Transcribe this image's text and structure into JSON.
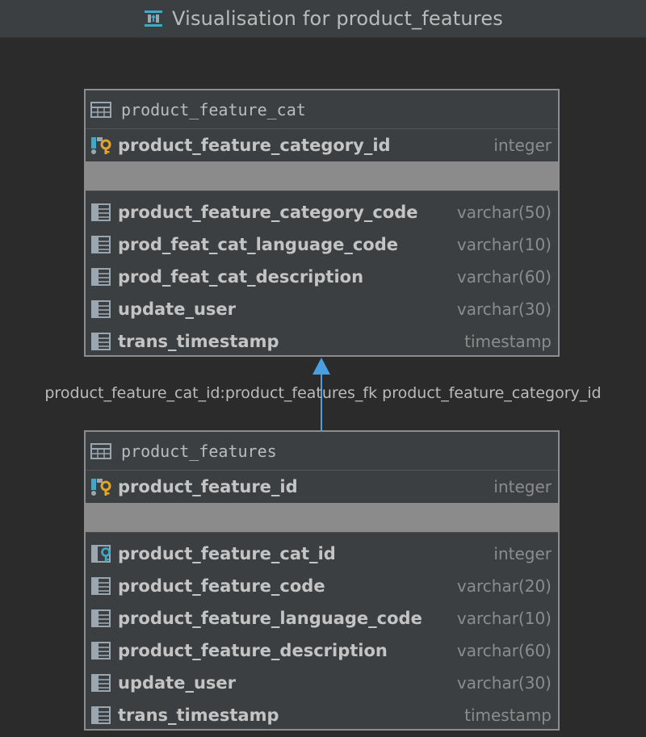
{
  "window": {
    "title": "Visualisation for product_features",
    "title_icon": "diagram-icon"
  },
  "tables": {
    "parent": {
      "name": "product_feature_cat",
      "primary_key": [
        {
          "name": "product_feature_category_id",
          "type": "integer",
          "icon": "primary-key-icon"
        }
      ],
      "columns": [
        {
          "name": "product_feature_category_code",
          "type": "varchar(50)",
          "icon": "column-icon"
        },
        {
          "name": "prod_feat_cat_language_code",
          "type": "varchar(10)",
          "icon": "column-icon"
        },
        {
          "name": "prod_feat_cat_description",
          "type": "varchar(60)",
          "icon": "column-icon"
        },
        {
          "name": "update_user",
          "type": "varchar(30)",
          "icon": "column-icon"
        },
        {
          "name": "trans_timestamp",
          "type": "timestamp",
          "icon": "column-icon"
        }
      ]
    },
    "child": {
      "name": "product_features",
      "primary_key": [
        {
          "name": "product_feature_id",
          "type": "integer",
          "icon": "primary-key-icon"
        }
      ],
      "columns": [
        {
          "name": "product_feature_cat_id",
          "type": "integer",
          "icon": "foreign-key-icon"
        },
        {
          "name": "product_feature_code",
          "type": "varchar(20)",
          "icon": "column-icon"
        },
        {
          "name": "product_feature_language_code",
          "type": "varchar(10)",
          "icon": "column-icon"
        },
        {
          "name": "product_feature_description",
          "type": "varchar(60)",
          "icon": "column-icon"
        },
        {
          "name": "update_user",
          "type": "varchar(30)",
          "icon": "column-icon"
        },
        {
          "name": "trans_timestamp",
          "type": "timestamp",
          "icon": "column-icon"
        }
      ]
    }
  },
  "relationship": {
    "label": "product_feature_cat_id:product_features_fk product_feature_category_id",
    "color": "#4a9fe0"
  },
  "colors": {
    "background": "#2b2b2b",
    "table_fill": "#3c3f41",
    "table_border": "#8c8c8c",
    "key_gold": "#e2a52b",
    "key_teal": "#3fa9c9"
  }
}
